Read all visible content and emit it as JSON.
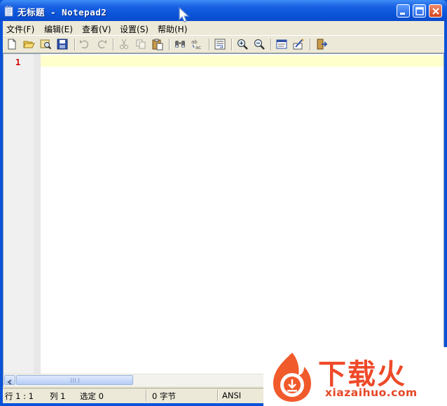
{
  "window": {
    "title": "无标题 - Notepad2"
  },
  "menu": [
    {
      "label": "文件(F)"
    },
    {
      "label": "编辑(E)"
    },
    {
      "label": "查看(V)"
    },
    {
      "label": "设置(S)"
    },
    {
      "label": "帮助(H)"
    }
  ],
  "toolbar": {
    "icons": [
      "new-file-icon",
      "open-folder-icon",
      "browse-icon",
      "save-icon",
      "undo-icon",
      "redo-icon",
      "cut-icon",
      "copy-icon",
      "paste-icon",
      "find-icon",
      "replace-icon",
      "word-wrap-icon",
      "zoom-in-icon",
      "zoom-out-icon",
      "schemes-icon",
      "customize-icon",
      "exit-icon"
    ]
  },
  "editor": {
    "line_number": "1"
  },
  "statusbar": {
    "position": "行 1 : 1",
    "column": "列 1",
    "selection": "选定 0",
    "bytes": "0 字节",
    "encoding": "ANSI"
  },
  "watermark": {
    "name": "下载火",
    "url": "xiazaihuo.com"
  },
  "colors": {
    "title_bar": "#0a53d8",
    "current_line": "#ffffcc",
    "line_number": "#d00000",
    "watermark": "#ee4a2a"
  }
}
